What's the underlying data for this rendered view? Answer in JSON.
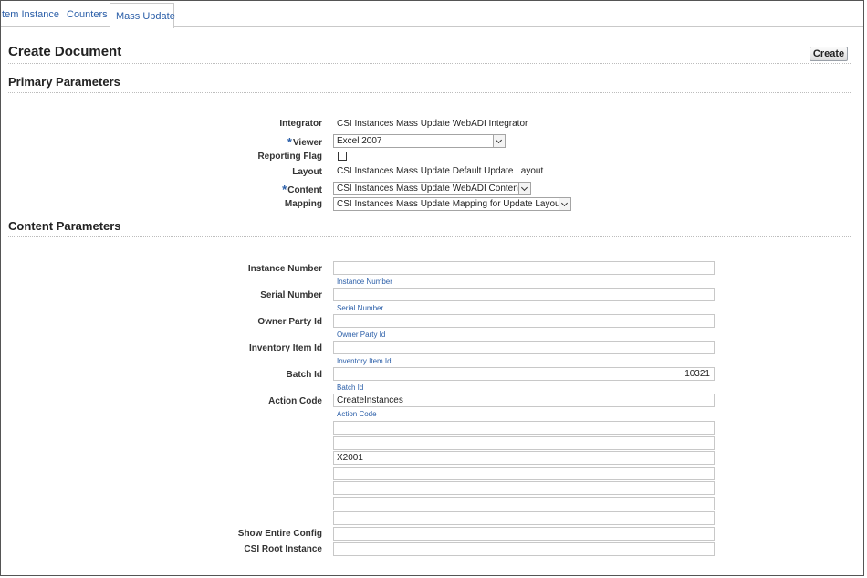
{
  "tabs": {
    "item_instance": "Item Instance",
    "counters": "Counters",
    "mass_update": "Mass Update"
  },
  "page_title": "Create Document",
  "create_button": "Create",
  "primary": {
    "heading": "Primary Parameters",
    "integrator_label": "Integrator",
    "integrator_value": "CSI Instances Mass Update WebADI Integrator",
    "viewer_label": "Viewer",
    "viewer_value": "Excel 2007",
    "reporting_flag_label": "Reporting Flag",
    "reporting_flag_checked": false,
    "layout_label": "Layout",
    "layout_value": "CSI Instances Mass Update Default Update Layout",
    "content_label": "Content",
    "content_value": "CSI Instances Mass Update WebADI Content",
    "mapping_label": "Mapping",
    "mapping_value": "CSI Instances Mass Update Mapping for Update Layout",
    "required_marker": "*"
  },
  "content": {
    "heading": "Content Parameters",
    "instance_number_label": "Instance Number",
    "instance_number_value": "",
    "instance_number_hint": "Instance Number",
    "serial_number_label": "Serial Number",
    "serial_number_value": "",
    "serial_number_hint": "Serial Number",
    "owner_party_id_label": "Owner Party Id",
    "owner_party_id_value": "",
    "owner_party_id_hint": "Owner Party Id",
    "inventory_item_id_label": "Inventory Item Id",
    "inventory_item_id_value": "",
    "inventory_item_id_hint": "Inventory Item Id",
    "batch_id_label": "Batch Id",
    "batch_id_value": "10321",
    "batch_id_hint": "Batch Id",
    "action_code_label": "Action Code",
    "action_code_value": "CreateInstances",
    "action_code_hint": "Action Code",
    "extra_fields": [
      "",
      "",
      "X2001",
      "",
      "",
      "",
      ""
    ],
    "show_entire_config_label": "Show Entire Config",
    "show_entire_config_value": "",
    "csi_root_instance_label": "CSI Root Instance",
    "csi_root_instance_value": ""
  }
}
